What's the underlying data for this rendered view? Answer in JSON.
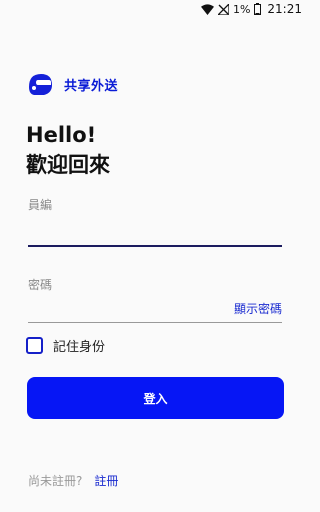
{
  "status_bar": {
    "icons": [
      "wifi-icon",
      "no-signal-icon",
      "battery-icon"
    ],
    "battery": "1%",
    "time": "21:21"
  },
  "brand": {
    "logo_icon": "helmet-icon",
    "name": "共享外送",
    "color": "#0a1bd6"
  },
  "greeting": {
    "hello": "Hello!",
    "welcome": "歡迎回來"
  },
  "form": {
    "employee_label": "員編",
    "employee_value": "",
    "password_label": "密碼",
    "password_value": "",
    "show_password": "顯示密碼",
    "remember_label": "記住身份",
    "remember_checked": false,
    "login_button": "登入",
    "button_color": "#0616f5"
  },
  "footer": {
    "register_prompt": "尚未註冊?",
    "register_link": "註冊"
  }
}
